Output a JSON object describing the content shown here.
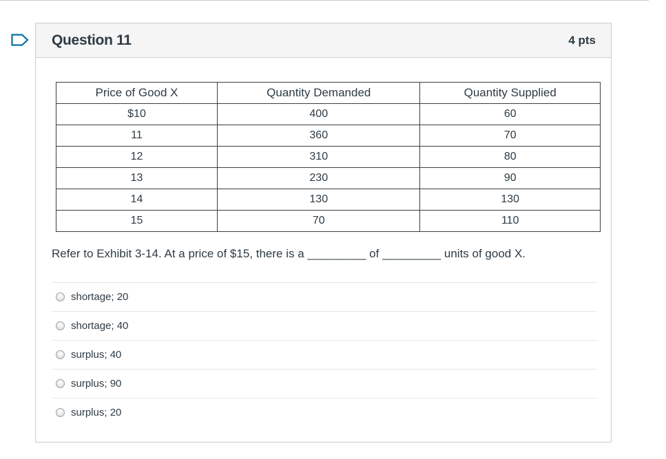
{
  "question": {
    "title": "Question 11",
    "points": "4 pts"
  },
  "exhibit": {
    "headers": [
      "Price of Good X",
      "Quantity Demanded",
      "Quantity Supplied"
    ],
    "rows": [
      [
        "$10",
        "400",
        "60"
      ],
      [
        "11",
        "360",
        "70"
      ],
      [
        "12",
        "310",
        "80"
      ],
      [
        "13",
        "230",
        "90"
      ],
      [
        "14",
        "130",
        "130"
      ],
      [
        "15",
        "70",
        "110"
      ]
    ]
  },
  "prompt": "Refer to Exhibit 3-14.  At a price of $15, there is a _________ of _________ units of good X.",
  "answers": [
    {
      "label": "shortage; 20"
    },
    {
      "label": "shortage; 40"
    },
    {
      "label": "surplus; 40"
    },
    {
      "label": "surplus; 90"
    },
    {
      "label": "surplus; 20"
    }
  ],
  "colors": {
    "flag": "#0770a3",
    "text": "#2d3b45",
    "border": "#c7cdd1",
    "header_bg": "#f5f5f5"
  },
  "icons": {
    "flag": "bookmark-flag-icon",
    "radio": "radio-button-icon"
  }
}
